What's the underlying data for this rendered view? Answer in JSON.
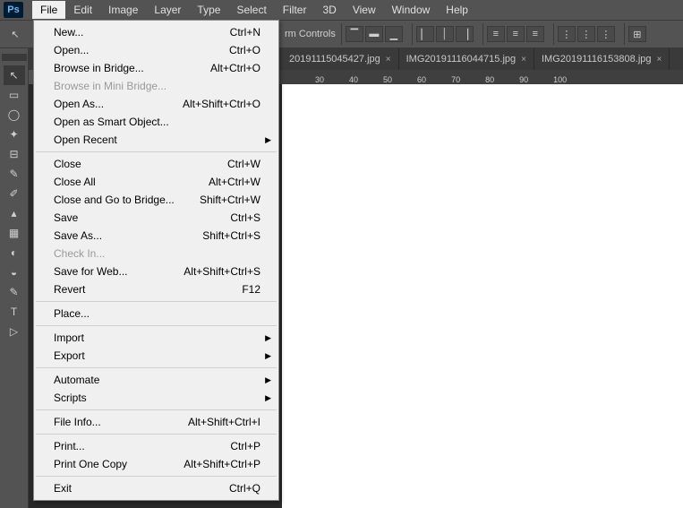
{
  "app_logo": "Ps",
  "menus": [
    "File",
    "Edit",
    "Image",
    "Layer",
    "Type",
    "Select",
    "Filter",
    "3D",
    "View",
    "Window",
    "Help"
  ],
  "active_menu_index": 0,
  "optionsbar": {
    "label": "rm Controls"
  },
  "tabs": [
    {
      "title": "20191115045427.jpg",
      "close": "×"
    },
    {
      "title": "IMG20191116044715.jpg",
      "close": "×"
    },
    {
      "title": "IMG20191116153808.jpg",
      "close": "×"
    }
  ],
  "ruler_ticks": [
    "30",
    "40",
    "50",
    "60",
    "70",
    "80",
    "90",
    "100"
  ],
  "dropdown": {
    "sections": [
      [
        {
          "label": "New...",
          "shortcut": "Ctrl+N",
          "disabled": false,
          "submenu": false
        },
        {
          "label": "Open...",
          "shortcut": "Ctrl+O",
          "disabled": false,
          "submenu": false
        },
        {
          "label": "Browse in Bridge...",
          "shortcut": "Alt+Ctrl+O",
          "disabled": false,
          "submenu": false
        },
        {
          "label": "Browse in Mini Bridge...",
          "shortcut": "",
          "disabled": true,
          "submenu": false
        },
        {
          "label": "Open As...",
          "shortcut": "Alt+Shift+Ctrl+O",
          "disabled": false,
          "submenu": false
        },
        {
          "label": "Open as Smart Object...",
          "shortcut": "",
          "disabled": false,
          "submenu": false
        },
        {
          "label": "Open Recent",
          "shortcut": "",
          "disabled": false,
          "submenu": true
        }
      ],
      [
        {
          "label": "Close",
          "shortcut": "Ctrl+W",
          "disabled": false,
          "submenu": false
        },
        {
          "label": "Close All",
          "shortcut": "Alt+Ctrl+W",
          "disabled": false,
          "submenu": false
        },
        {
          "label": "Close and Go to Bridge...",
          "shortcut": "Shift+Ctrl+W",
          "disabled": false,
          "submenu": false
        },
        {
          "label": "Save",
          "shortcut": "Ctrl+S",
          "disabled": false,
          "submenu": false
        },
        {
          "label": "Save As...",
          "shortcut": "Shift+Ctrl+S",
          "disabled": false,
          "submenu": false
        },
        {
          "label": "Check In...",
          "shortcut": "",
          "disabled": true,
          "submenu": false
        },
        {
          "label": "Save for Web...",
          "shortcut": "Alt+Shift+Ctrl+S",
          "disabled": false,
          "submenu": false
        },
        {
          "label": "Revert",
          "shortcut": "F12",
          "disabled": false,
          "submenu": false
        }
      ],
      [
        {
          "label": "Place...",
          "shortcut": "",
          "disabled": false,
          "submenu": false
        }
      ],
      [
        {
          "label": "Import",
          "shortcut": "",
          "disabled": false,
          "submenu": true
        },
        {
          "label": "Export",
          "shortcut": "",
          "disabled": false,
          "submenu": true
        }
      ],
      [
        {
          "label": "Automate",
          "shortcut": "",
          "disabled": false,
          "submenu": true
        },
        {
          "label": "Scripts",
          "shortcut": "",
          "disabled": false,
          "submenu": true
        }
      ],
      [
        {
          "label": "File Info...",
          "shortcut": "Alt+Shift+Ctrl+I",
          "disabled": false,
          "submenu": false
        }
      ],
      [
        {
          "label": "Print...",
          "shortcut": "Ctrl+P",
          "disabled": false,
          "submenu": false
        },
        {
          "label": "Print One Copy",
          "shortcut": "Alt+Shift+Ctrl+P",
          "disabled": false,
          "submenu": false
        }
      ],
      [
        {
          "label": "Exit",
          "shortcut": "Ctrl+Q",
          "disabled": false,
          "submenu": false
        }
      ]
    ]
  },
  "tool_icons": [
    "↖",
    "▭",
    "◯",
    "✦",
    "⊟",
    "✎",
    "✐",
    "▴",
    "▦",
    "◐",
    "◒",
    "✎",
    "T",
    "▷"
  ]
}
